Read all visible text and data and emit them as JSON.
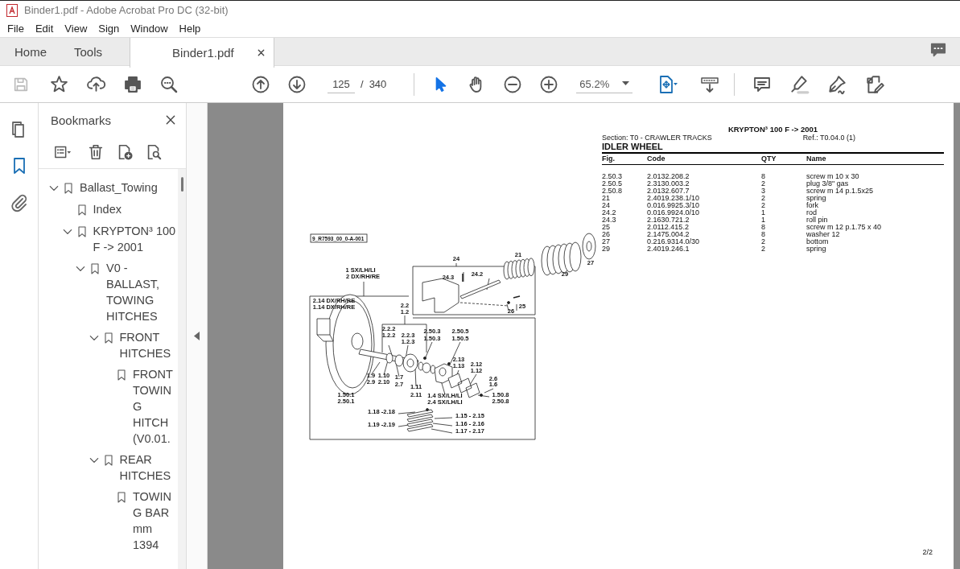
{
  "window": {
    "title": "Binder1.pdf - Adobe Acrobat Pro DC (32-bit)"
  },
  "menu": [
    "File",
    "Edit",
    "View",
    "Sign",
    "Window",
    "Help"
  ],
  "tabs": [
    {
      "label": "Home",
      "selected": false
    },
    {
      "label": "Tools",
      "selected": false
    },
    {
      "label": "Binder1.pdf",
      "selected": true,
      "closable": true
    }
  ],
  "toolbar": {
    "save": {
      "disabled": true
    },
    "page_number": "125",
    "page_separator": "/",
    "page_count": "340",
    "tools": [
      {
        "kind": "select",
        "selected": true
      },
      {
        "kind": "hand",
        "selected": false
      }
    ],
    "zoom": "65.2%"
  },
  "rail": [
    {
      "kind": "pages",
      "selected": false
    },
    {
      "kind": "bookmarks",
      "selected": true
    },
    {
      "kind": "attachments",
      "selected": false
    }
  ],
  "bookmarks": {
    "title": "Bookmarks",
    "tree": [
      {
        "label": "Ballast_Towing",
        "expanded": true,
        "children": [
          {
            "label": "Index"
          },
          {
            "label": "KRYPTON³ 100 F -> 2001",
            "expanded": true,
            "children": [
              {
                "label": "V0 - BALLAST, TOWING HITCHES",
                "expanded": true,
                "children": [
                  {
                    "label": "FRONT HITCHES",
                    "expanded": true,
                    "children": [
                      {
                        "label": "FRONT TOWING HITCH (V0.01."
                      }
                    ]
                  },
                  {
                    "label": "REAR HITCHES",
                    "expanded": true,
                    "children": [
                      {
                        "label": "TOWING BAR mm 1394"
                      }
                    ]
                  }
                ]
              }
            ]
          }
        ]
      }
    ]
  },
  "document": {
    "model": "KRYPTON³ 100 F -> 2001",
    "section": "Section: T0 - CRAWLER TRACKS",
    "ref": "Ref.: T0.04.0 (1)",
    "heading": "IDLER WHEEL",
    "columns": [
      "Fig.",
      "Code",
      "QTY",
      "Name"
    ],
    "rows": [
      [
        "2.50.3",
        "2.0132.208.2",
        "8",
        "screw m 10 x 30"
      ],
      [
        "2.50.5",
        "2.3130.003.2",
        "2",
        "plug 3/8\" gas"
      ],
      [
        "2.50.8",
        "2.0132.607.7",
        "3",
        "screw m 14 p.1.5x25"
      ],
      [
        "21",
        "2.4019.238.1/10",
        "2",
        "spring"
      ],
      [
        "24",
        "0.016.9925.3/10",
        "2",
        "fork"
      ],
      [
        "24.2",
        "0.016.9924.0/10",
        "1",
        "rod"
      ],
      [
        "24.3",
        "2.1630.721.2",
        "1",
        "roll pin"
      ],
      [
        "25",
        "2.0112.415.2",
        "8",
        "screw m 12 p.1.75 x 40"
      ],
      [
        "26",
        "2.1475.004.2",
        "8",
        "washer 12"
      ],
      [
        "27",
        "0.216.9314.0/30",
        "2",
        "bottom"
      ],
      [
        "29",
        "2.4019.246.1",
        "2",
        "spring"
      ]
    ],
    "diagram": {
      "drawing_id": "9_R7593_00_0-A-001",
      "callouts": [
        "24",
        "24.3",
        "24.2",
        "21",
        "29",
        "27",
        "25",
        "26",
        "1 SX/LH/LI",
        "2 DX/RH/RE",
        "2.14 DX/RH/RE",
        "1.14 DX/RH/RE",
        "2.2",
        "1.2",
        "2.2.2",
        "1.2.2",
        "2.2.3",
        "1.2.3",
        "2.50.3",
        "1.50.3",
        "2.50.5",
        "1.50.5",
        "2.13",
        "1.13",
        "2.12",
        "1.12",
        "2.6",
        "1.6",
        "1.9",
        "2.9",
        "1.10",
        "2.10",
        "1.7",
        "2.7",
        "1.11",
        "2.11",
        "1.4 SX/LH/LI",
        "2.4 SX/LH/LI",
        "1.50.8",
        "2.50.8",
        "1.50.1",
        "2.50.1",
        "1.18 -2.18",
        "1.19 -2.19",
        "1.15 - 2.15",
        "1.16 - 2.16",
        "1.17 - 2.17"
      ]
    },
    "page_label": "2/2"
  }
}
